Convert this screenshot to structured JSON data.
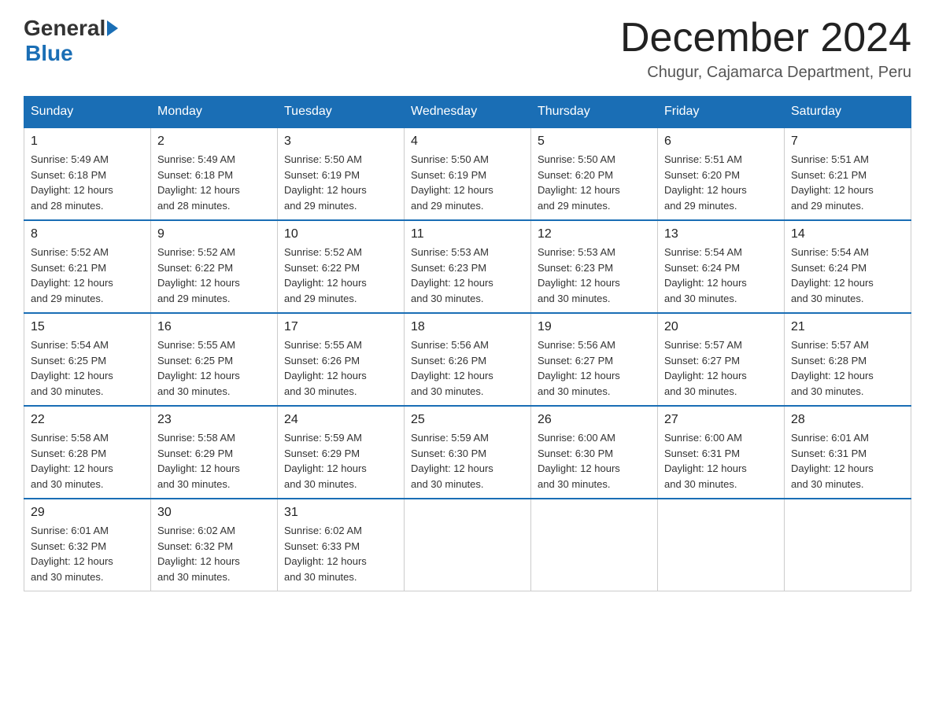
{
  "header": {
    "logo_general": "General",
    "logo_blue": "Blue",
    "month_title": "December 2024",
    "location": "Chugur, Cajamarca Department, Peru"
  },
  "days_of_week": [
    "Sunday",
    "Monday",
    "Tuesday",
    "Wednesday",
    "Thursday",
    "Friday",
    "Saturday"
  ],
  "weeks": [
    [
      {
        "day": "1",
        "sunrise": "5:49 AM",
        "sunset": "6:18 PM",
        "daylight": "12 hours and 28 minutes."
      },
      {
        "day": "2",
        "sunrise": "5:49 AM",
        "sunset": "6:18 PM",
        "daylight": "12 hours and 28 minutes."
      },
      {
        "day": "3",
        "sunrise": "5:50 AM",
        "sunset": "6:19 PM",
        "daylight": "12 hours and 29 minutes."
      },
      {
        "day": "4",
        "sunrise": "5:50 AM",
        "sunset": "6:19 PM",
        "daylight": "12 hours and 29 minutes."
      },
      {
        "day": "5",
        "sunrise": "5:50 AM",
        "sunset": "6:20 PM",
        "daylight": "12 hours and 29 minutes."
      },
      {
        "day": "6",
        "sunrise": "5:51 AM",
        "sunset": "6:20 PM",
        "daylight": "12 hours and 29 minutes."
      },
      {
        "day": "7",
        "sunrise": "5:51 AM",
        "sunset": "6:21 PM",
        "daylight": "12 hours and 29 minutes."
      }
    ],
    [
      {
        "day": "8",
        "sunrise": "5:52 AM",
        "sunset": "6:21 PM",
        "daylight": "12 hours and 29 minutes."
      },
      {
        "day": "9",
        "sunrise": "5:52 AM",
        "sunset": "6:22 PM",
        "daylight": "12 hours and 29 minutes."
      },
      {
        "day": "10",
        "sunrise": "5:52 AM",
        "sunset": "6:22 PM",
        "daylight": "12 hours and 29 minutes."
      },
      {
        "day": "11",
        "sunrise": "5:53 AM",
        "sunset": "6:23 PM",
        "daylight": "12 hours and 30 minutes."
      },
      {
        "day": "12",
        "sunrise": "5:53 AM",
        "sunset": "6:23 PM",
        "daylight": "12 hours and 30 minutes."
      },
      {
        "day": "13",
        "sunrise": "5:54 AM",
        "sunset": "6:24 PM",
        "daylight": "12 hours and 30 minutes."
      },
      {
        "day": "14",
        "sunrise": "5:54 AM",
        "sunset": "6:24 PM",
        "daylight": "12 hours and 30 minutes."
      }
    ],
    [
      {
        "day": "15",
        "sunrise": "5:54 AM",
        "sunset": "6:25 PM",
        "daylight": "12 hours and 30 minutes."
      },
      {
        "day": "16",
        "sunrise": "5:55 AM",
        "sunset": "6:25 PM",
        "daylight": "12 hours and 30 minutes."
      },
      {
        "day": "17",
        "sunrise": "5:55 AM",
        "sunset": "6:26 PM",
        "daylight": "12 hours and 30 minutes."
      },
      {
        "day": "18",
        "sunrise": "5:56 AM",
        "sunset": "6:26 PM",
        "daylight": "12 hours and 30 minutes."
      },
      {
        "day": "19",
        "sunrise": "5:56 AM",
        "sunset": "6:27 PM",
        "daylight": "12 hours and 30 minutes."
      },
      {
        "day": "20",
        "sunrise": "5:57 AM",
        "sunset": "6:27 PM",
        "daylight": "12 hours and 30 minutes."
      },
      {
        "day": "21",
        "sunrise": "5:57 AM",
        "sunset": "6:28 PM",
        "daylight": "12 hours and 30 minutes."
      }
    ],
    [
      {
        "day": "22",
        "sunrise": "5:58 AM",
        "sunset": "6:28 PM",
        "daylight": "12 hours and 30 minutes."
      },
      {
        "day": "23",
        "sunrise": "5:58 AM",
        "sunset": "6:29 PM",
        "daylight": "12 hours and 30 minutes."
      },
      {
        "day": "24",
        "sunrise": "5:59 AM",
        "sunset": "6:29 PM",
        "daylight": "12 hours and 30 minutes."
      },
      {
        "day": "25",
        "sunrise": "5:59 AM",
        "sunset": "6:30 PM",
        "daylight": "12 hours and 30 minutes."
      },
      {
        "day": "26",
        "sunrise": "6:00 AM",
        "sunset": "6:30 PM",
        "daylight": "12 hours and 30 minutes."
      },
      {
        "day": "27",
        "sunrise": "6:00 AM",
        "sunset": "6:31 PM",
        "daylight": "12 hours and 30 minutes."
      },
      {
        "day": "28",
        "sunrise": "6:01 AM",
        "sunset": "6:31 PM",
        "daylight": "12 hours and 30 minutes."
      }
    ],
    [
      {
        "day": "29",
        "sunrise": "6:01 AM",
        "sunset": "6:32 PM",
        "daylight": "12 hours and 30 minutes."
      },
      {
        "day": "30",
        "sunrise": "6:02 AM",
        "sunset": "6:32 PM",
        "daylight": "12 hours and 30 minutes."
      },
      {
        "day": "31",
        "sunrise": "6:02 AM",
        "sunset": "6:33 PM",
        "daylight": "12 hours and 30 minutes."
      },
      null,
      null,
      null,
      null
    ]
  ],
  "labels": {
    "sunrise": "Sunrise:",
    "sunset": "Sunset:",
    "daylight": "Daylight:"
  }
}
